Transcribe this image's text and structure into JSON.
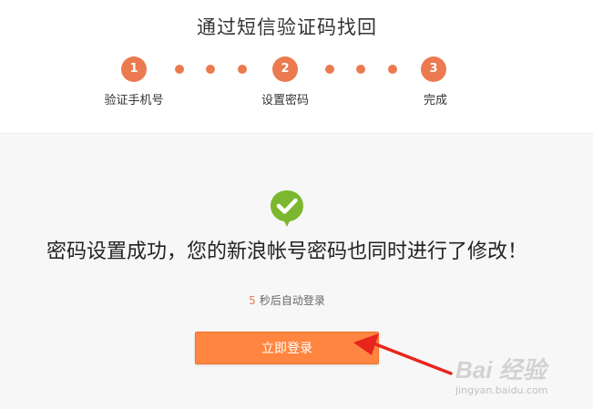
{
  "header": {
    "title": "通过短信验证码找回"
  },
  "steps": [
    {
      "number": "1",
      "label": "验证手机号"
    },
    {
      "number": "2",
      "label": "设置密码"
    },
    {
      "number": "3",
      "label": "完成"
    }
  ],
  "result": {
    "icon": "check-bubble-icon",
    "message": "密码设置成功，您的新浪帐号密码也同时进行了修改！",
    "countdown_number": "5",
    "countdown_text": "秒后自动登录",
    "login_button_label": "立即登录"
  },
  "watermark": {
    "logo_text": "Bai 经验",
    "url_text": "jingyan.baidu.com"
  },
  "colors": {
    "accent": "#ec7a50",
    "button": "#ff8540",
    "success": "#7cb82f",
    "arrow": "#e8251d"
  }
}
